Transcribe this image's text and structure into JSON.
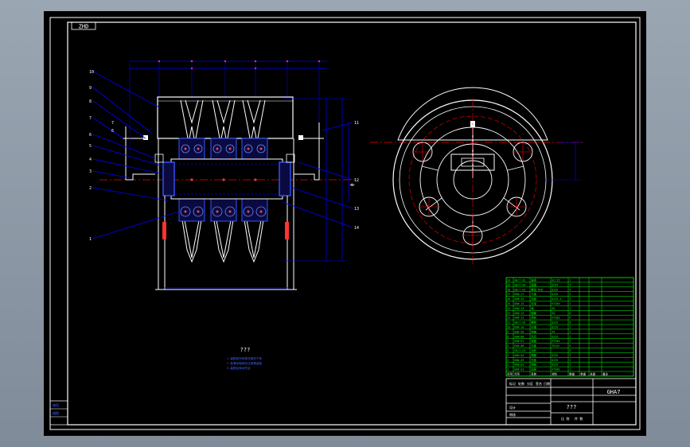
{
  "drawing": {
    "sheet_tag": "ZHD",
    "title_mark": "???",
    "notes": [
      "1.装配前所有零件清洗干净",
      "2.各滑动轴承加注润滑油脂",
      "3.装配后转动灵活"
    ],
    "dim_label": "ф",
    "callout_left": [
      "10",
      "9",
      "8",
      "7",
      "6",
      "5",
      "4",
      "3",
      "2",
      "1"
    ],
    "callout_right": [
      "11",
      "12",
      "13",
      "14"
    ]
  },
  "bom": {
    "rows": [
      [
        "20",
        "GB/T-02",
        "轴承",
        "GCr15",
        "2",
        "",
        "",
        ""
      ],
      [
        "19",
        "GB/T-04",
        "垫圈",
        "Q235",
        "4",
        "",
        "",
        ""
      ],
      [
        "18",
        "GB/T-01",
        "螺母 M16",
        "Q235",
        "4",
        "",
        "",
        ""
      ],
      [
        "17",
        "GHW-17",
        "卡板",
        "Q235",
        "2",
        "",
        "",
        ""
      ],
      [
        "16",
        "GHW-16",
        "挡板",
        "Q235-A",
        "2",
        "",
        "",
        ""
      ],
      [
        "15",
        "GHW-15",
        "支架",
        "HT200",
        "2",
        "",
        "",
        ""
      ],
      [
        "14",
        "GHW-14",
        "轴",
        "45",
        "1",
        "",
        "",
        ""
      ],
      [
        "13",
        "GHW-13",
        "轴套",
        "45",
        "6",
        "",
        "",
        ""
      ],
      [
        "12",
        "GHW-12",
        "滑轮",
        "HT200",
        "6",
        "",
        "",
        ""
      ],
      [
        "11",
        "GB/T-05",
        "螺栓",
        "Q235",
        "8",
        "",
        "",
        ""
      ],
      [
        "10",
        "GHW-10",
        "护罩",
        "Q235",
        "1",
        "",
        "",
        ""
      ],
      [
        "9",
        "GHW-09",
        "销轴",
        "45",
        "2",
        "",
        "",
        ""
      ],
      [
        "8",
        "GHW-08",
        "吊耳",
        "Q235",
        "2",
        "",
        "",
        ""
      ],
      [
        "7",
        "GHW-07",
        "端盖",
        "HT200",
        "2",
        "",
        "",
        ""
      ],
      [
        "6",
        "GHW-06",
        "衬套",
        "ZCuSn",
        "6",
        "",
        "",
        ""
      ],
      [
        "5",
        "GB/T-03",
        "油杯",
        "",
        "6",
        "",
        "",
        ""
      ],
      [
        "4",
        "GHW-04",
        "隔套",
        "Q235",
        "5",
        "",
        "",
        ""
      ],
      [
        "3",
        "GHW-03",
        "压板",
        "Q235",
        "2",
        "",
        "",
        ""
      ],
      [
        "2",
        "GHW-02",
        "侧板",
        "Q235",
        "2",
        "",
        "",
        ""
      ],
      [
        "1",
        "GHW-01",
        "底座",
        "HT200",
        "1",
        "",
        "",
        ""
      ]
    ],
    "header": [
      "序号",
      "代号",
      "名称",
      "材料",
      "数量",
      "单重",
      "总重",
      "备注"
    ]
  },
  "title_block": {
    "drawing_no": "GHA7",
    "name": "???",
    "scale": "比 例",
    "qty": "件 数",
    "left_labels": [
      "设计",
      "审核"
    ],
    "stamp_labels": [
      "标记",
      "处数",
      "分区",
      "签名",
      "日期"
    ]
  },
  "left_stamp": {
    "labels": [
      "借用",
      "描图"
    ]
  }
}
